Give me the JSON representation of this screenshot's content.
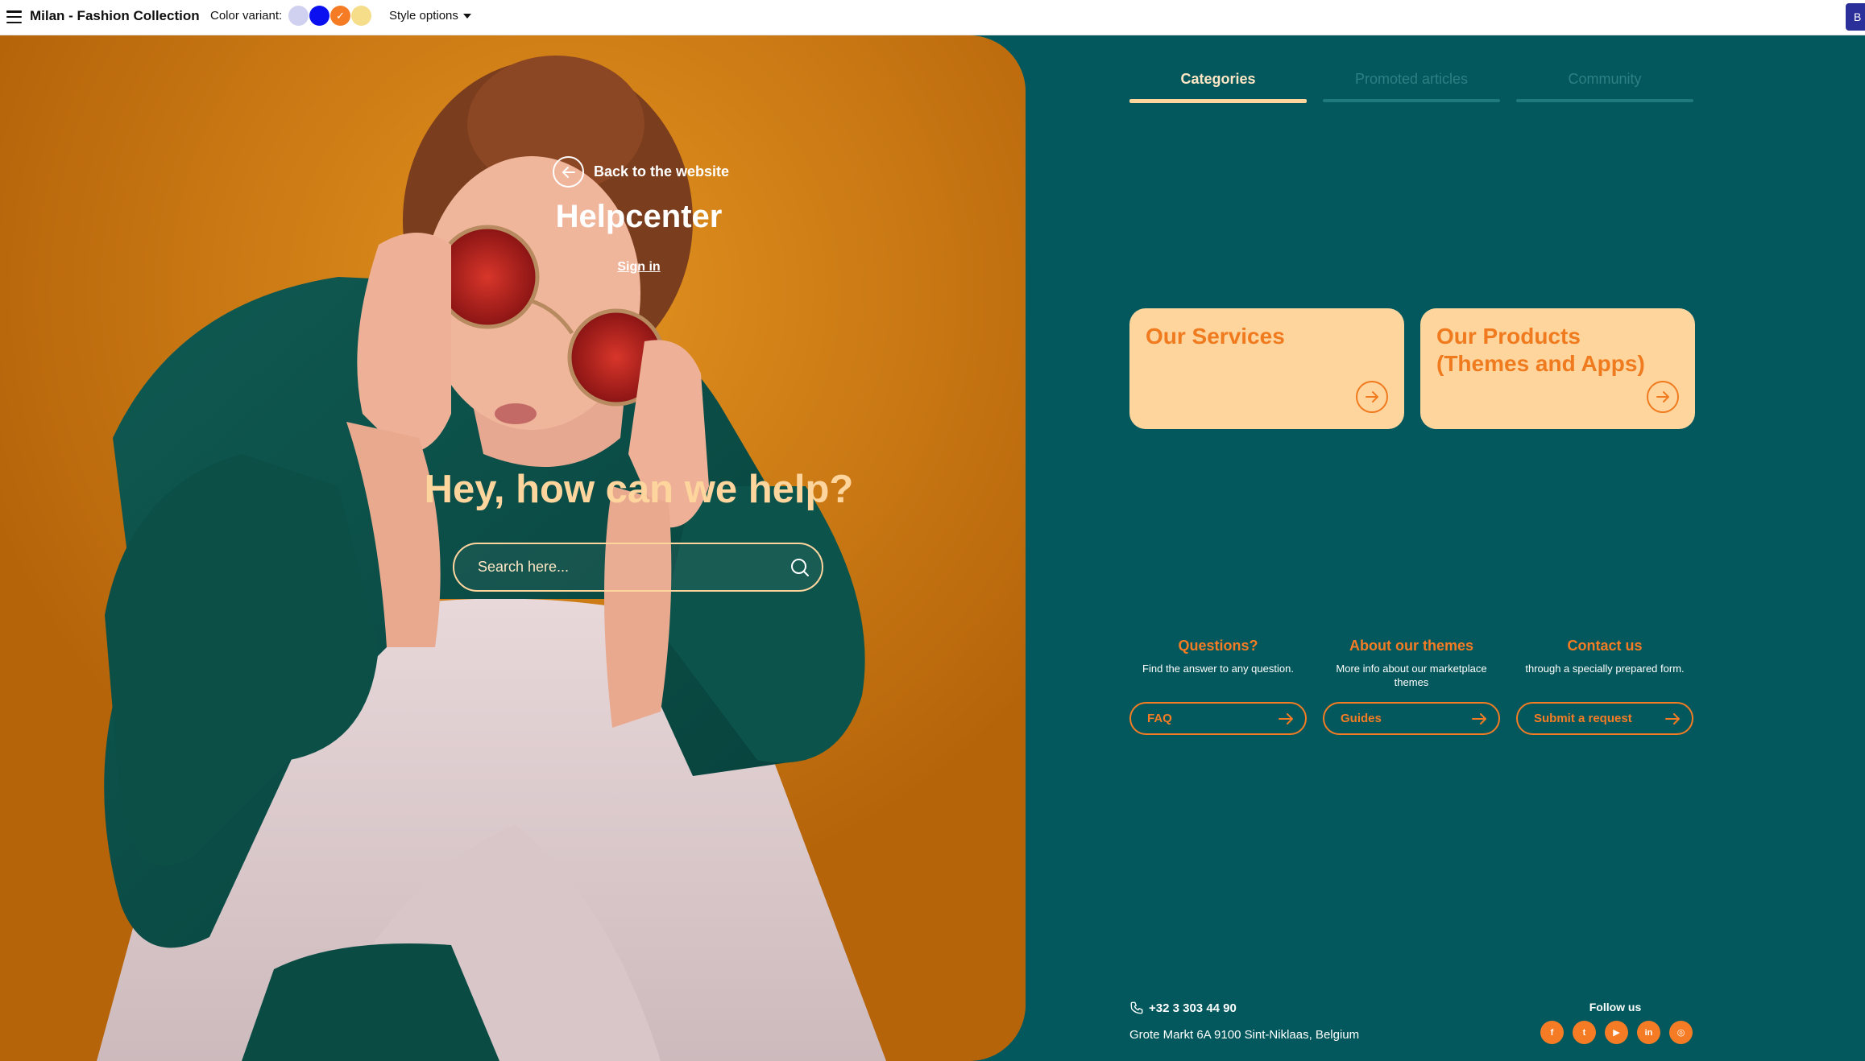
{
  "topbar": {
    "title": "Milan - Fashion Collection",
    "color_variant_label": "Color variant:",
    "swatches": [
      {
        "name": "lavender",
        "color": "#d0d0f0",
        "selected": false
      },
      {
        "name": "blue",
        "color": "#0a10f0",
        "selected": false
      },
      {
        "name": "orange",
        "color": "#f57c24",
        "selected": true
      },
      {
        "name": "yellow",
        "color": "#f6dd8a",
        "selected": false
      }
    ],
    "style_options_label": "Style options",
    "corner_button_label": "B"
  },
  "hero": {
    "back_label": "Back to the website",
    "title": "Helpcenter",
    "signin_label": "Sign in",
    "question": "Hey, how can we help?",
    "search_placeholder": "Search here..."
  },
  "tabs": [
    {
      "label": "Categories",
      "active": true
    },
    {
      "label": "Promoted articles",
      "active": false
    },
    {
      "label": "Community",
      "active": false
    }
  ],
  "cards": [
    {
      "title": "Our Services"
    },
    {
      "title": "Our Products (Themes and Apps)"
    }
  ],
  "info": [
    {
      "title": "Questions?",
      "text": "Find the answer to any question.",
      "button": "FAQ"
    },
    {
      "title": "About our themes",
      "text": "More info about our marketplace themes",
      "button": "Guides"
    },
    {
      "title": "Contact us",
      "text": "through a specially prepared form.",
      "button": "Submit a request"
    }
  ],
  "footer": {
    "phone": "+32 3 303 44 90",
    "address": "Grote Markt 6A 9100 Sint-Niklaas, Belgium",
    "follow_label": "Follow us",
    "socials": [
      {
        "name": "facebook",
        "glyph": "f"
      },
      {
        "name": "twitter",
        "glyph": "t"
      },
      {
        "name": "youtube",
        "glyph": "▶"
      },
      {
        "name": "linkedin",
        "glyph": "in"
      },
      {
        "name": "instagram",
        "glyph": "◎"
      }
    ]
  },
  "colors": {
    "panel_bg": "#02585c",
    "accent_orange": "#f57c24",
    "peach": "#ffd59e"
  }
}
